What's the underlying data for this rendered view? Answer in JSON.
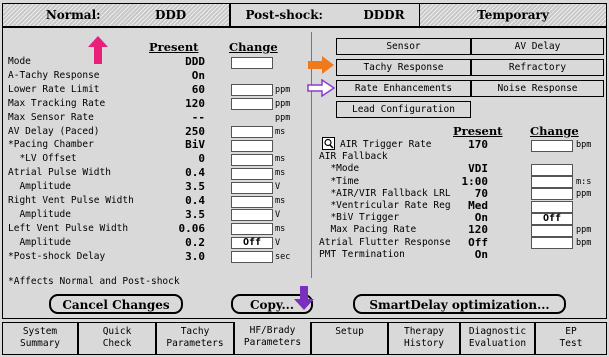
{
  "topbar": {
    "normal_label": "Normal:",
    "normal_value": "DDD",
    "postshock_label": "Post-shock:",
    "postshock_value": "DDDR",
    "temporary_label": "Temporary"
  },
  "left": {
    "header_present": "Present",
    "header_change": "Change",
    "rows": [
      {
        "label": "Mode",
        "value": "DDD",
        "change": "",
        "unit": ""
      },
      {
        "label": "A-Tachy Response",
        "value": "On",
        "change": null,
        "unit": ""
      },
      {
        "label": "Lower Rate Limit",
        "value": "60",
        "change": "",
        "unit": "ppm"
      },
      {
        "label": "Max Tracking Rate",
        "value": "120",
        "change": "",
        "unit": "ppm"
      },
      {
        "label": "Max Sensor Rate",
        "value": "--",
        "change": null,
        "unit": "ppm"
      },
      {
        "label": "AV Delay (Paced)",
        "value": "250",
        "change": "",
        "unit": "ms"
      },
      {
        "label": "*Pacing Chamber",
        "value": "BiV",
        "change": "",
        "unit": ""
      },
      {
        "label": "  *LV Offset",
        "value": "0",
        "change": "",
        "unit": "ms"
      },
      {
        "label": "Atrial Pulse Width",
        "value": "0.4",
        "change": "",
        "unit": "ms"
      },
      {
        "label": "  Amplitude",
        "value": "3.5",
        "change": "",
        "unit": "V"
      },
      {
        "label": "Right Vent Pulse Width",
        "value": "0.4",
        "change": "",
        "unit": "ms"
      },
      {
        "label": "  Amplitude",
        "value": "3.5",
        "change": "",
        "unit": "V"
      },
      {
        "label": "Left Vent Pulse Width",
        "value": "0.06",
        "change": "",
        "unit": "ms"
      },
      {
        "label": "  Amplitude",
        "value": "0.2",
        "change": "Off",
        "unit": "V"
      },
      {
        "label": "*Post-shock Delay",
        "value": "3.0",
        "change": "",
        "unit": "sec"
      }
    ],
    "footnote": "*Affects Normal and Post-shock"
  },
  "buttons": {
    "cancel": "Cancel Changes",
    "copy": "Copy...",
    "smartdelay": "SmartDelay optimization..."
  },
  "panel_buttons": {
    "sensor": "Sensor",
    "av_delay": "AV Delay",
    "tachy_response": "Tachy Response",
    "refractory": "Refractory",
    "rate_enhancements": "Rate Enhancements",
    "noise_response": "Noise Response",
    "lead_configuration": "Lead Configuration"
  },
  "right": {
    "header_present": "Present",
    "header_change": "Change",
    "rows": [
      {
        "label": "AIR Trigger Rate",
        "value": "170",
        "change": "",
        "unit": "bpm"
      },
      {
        "label": "AIR Fallback",
        "value": "",
        "change": null,
        "unit": ""
      },
      {
        "label": "  *Mode",
        "value": "VDI",
        "change": "",
        "unit": ""
      },
      {
        "label": "  *Time",
        "value": "1:00",
        "change": "",
        "unit": "m:s"
      },
      {
        "label": "  *AIR/VIR Fallback LRL",
        "value": "70",
        "change": "",
        "unit": "ppm"
      },
      {
        "label": "  *Ventricular Rate Reg",
        "value": "Med",
        "change": "",
        "unit": ""
      },
      {
        "label": "  *BiV Trigger",
        "value": "On",
        "change": "Off",
        "unit": ""
      },
      {
        "label": "  Max Pacing Rate",
        "value": "120",
        "change": "",
        "unit": "ppm"
      },
      {
        "label": "Atrial Flutter Response",
        "value": "Off",
        "change": "",
        "unit": "bpm"
      },
      {
        "label": "PMT Termination",
        "value": "On",
        "change": null,
        "unit": ""
      }
    ]
  },
  "tabs": [
    {
      "line1": "System",
      "line2": "Summary"
    },
    {
      "line1": "Quick",
      "line2": "Check"
    },
    {
      "line1": "Tachy",
      "line2": "Parameters"
    },
    {
      "line1": "HF/Brady",
      "line2": "Parameters"
    },
    {
      "line1": "Setup",
      "line2": ""
    },
    {
      "line1": "Therapy",
      "line2": "History"
    },
    {
      "line1": "Diagnostic",
      "line2": "Evaluation"
    },
    {
      "line1": "EP",
      "line2": "Test"
    }
  ],
  "colors": {
    "pink_arrow": "#e8207a",
    "orange_arrow": "#f07a1a",
    "purple_arrow": "#7a2fbf",
    "hollow_arrow": "#8a3cc8"
  },
  "icons": [
    "up-arrow-annotation-icon",
    "right-arrow-annotation-icon",
    "hollow-right-arrow-annotation-icon",
    "down-arrow-annotation-icon",
    "magnifier-icon"
  ]
}
